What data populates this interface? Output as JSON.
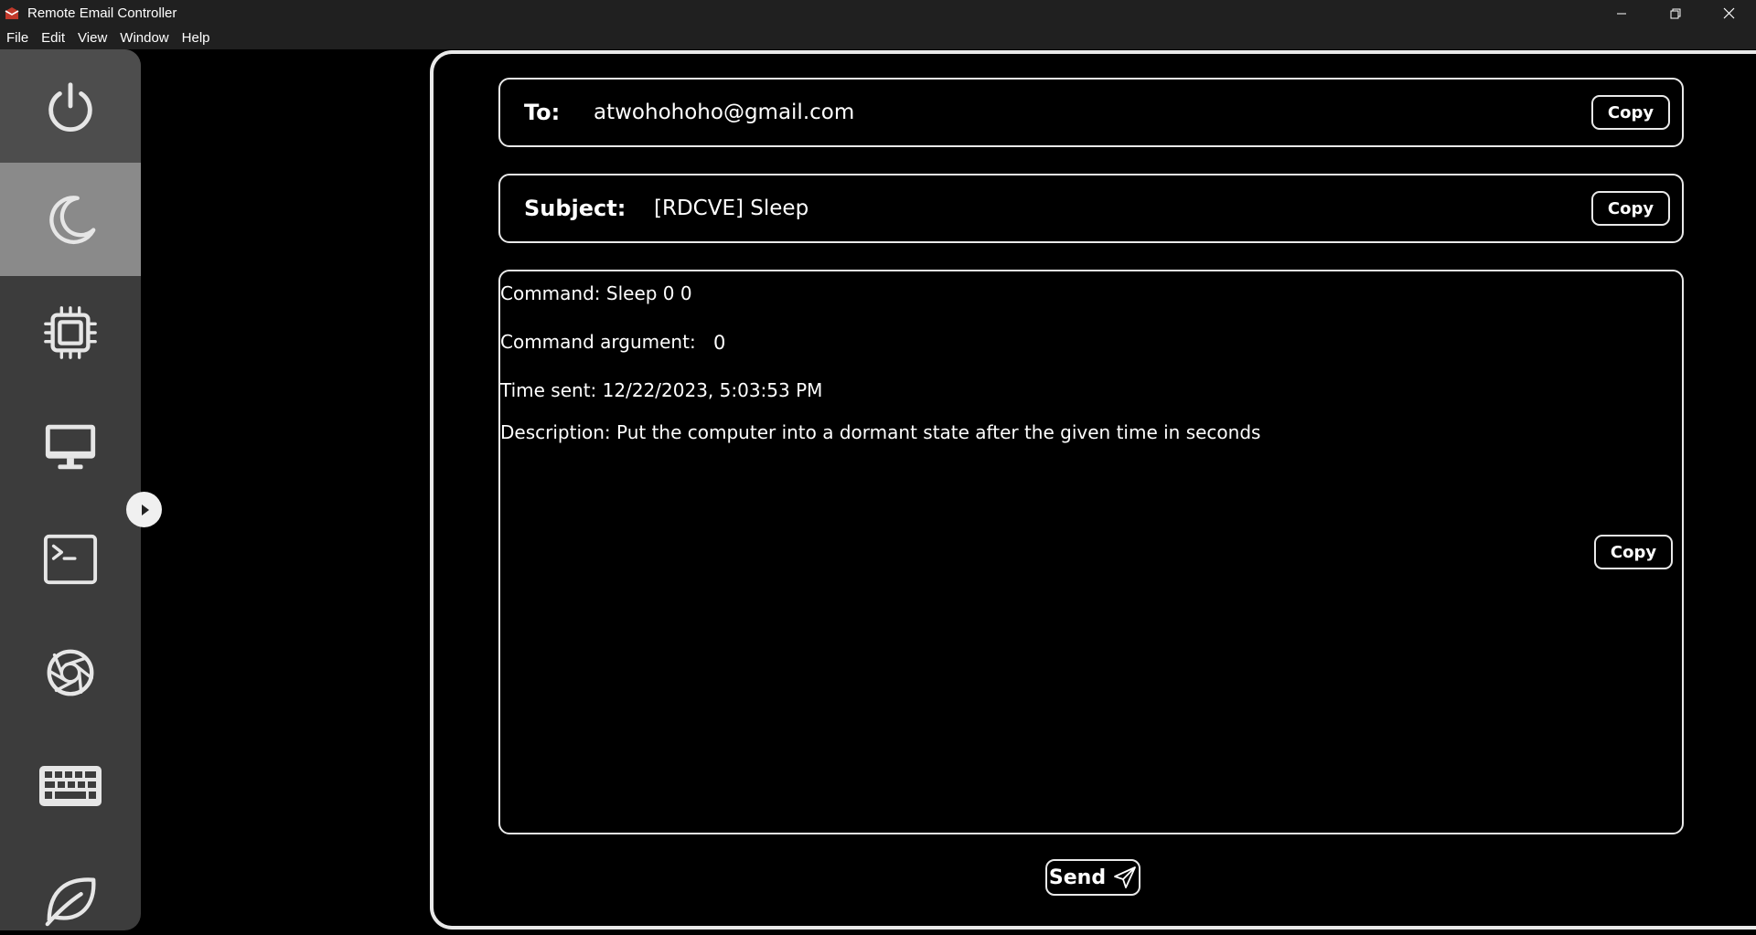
{
  "window": {
    "title": "Remote Email Controller",
    "accent_color": "#c0392b"
  },
  "menu": {
    "items": [
      "File",
      "Edit",
      "View",
      "Window",
      "Help"
    ]
  },
  "sidebar": {
    "items": [
      {
        "icon": "power-icon",
        "state": "normal"
      },
      {
        "icon": "moon-icon",
        "state": "selected"
      },
      {
        "icon": "cpu-chip-icon",
        "state": "normal"
      },
      {
        "icon": "monitor-icon",
        "state": "normal"
      },
      {
        "icon": "terminal-icon",
        "state": "normal"
      },
      {
        "icon": "camera-aperture-icon",
        "state": "normal"
      },
      {
        "icon": "keyboard-icon",
        "state": "normal"
      },
      {
        "icon": "leaf-icon",
        "state": "normal"
      }
    ]
  },
  "email": {
    "to_label": "To:",
    "to_value": "atwohohoho@gmail.com",
    "subject_label": "Subject:",
    "subject_value": "[RDCVE] Sleep",
    "copy_label": "Copy",
    "body": {
      "command": "Command: Sleep 0 0",
      "argument_label": "Command argument:",
      "argument_value": "0",
      "time_sent": "Time sent: 12/22/2023, 5:03:53 PM",
      "description": "Description: Put the computer into a dormant state after the given time in seconds"
    },
    "send_label": "Send"
  }
}
